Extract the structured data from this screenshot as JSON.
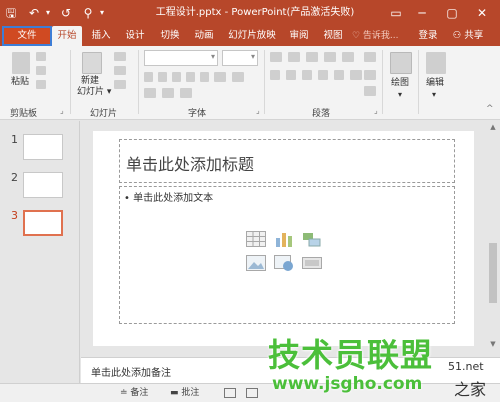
{
  "titlebar": {
    "title": "工程设计.pptx - PowerPoint(产品激活失败)",
    "save_glyph": "🖫",
    "undo_glyph": "↶",
    "redo_glyph": "↺",
    "qa_more_glyph": "⚲",
    "ribbon_display_glyph": "▭",
    "minimize_glyph": "─",
    "restore_glyph": "▢",
    "close_glyph": "✕"
  },
  "tabs": {
    "file": "文件",
    "home": "开始",
    "insert": "插入",
    "design": "设计",
    "transitions": "切换",
    "animations": "动画",
    "slideshow": "幻灯片放映",
    "review": "审阅",
    "view": "视图",
    "tellme": "♡ 告诉我...",
    "login": "登录",
    "share": "⚇ 共享"
  },
  "ribbon": {
    "clipboard_label": "剪贴板",
    "paste_label": "粘贴",
    "slides_label": "幻灯片",
    "new_slide_label_1": "新建",
    "new_slide_label_2": "幻灯片 ▾",
    "font_label": "字体",
    "paragraph_label": "段落",
    "drawing_label": "绘图",
    "editing_label": "编辑",
    "collapse_glyph": "^",
    "launcher_glyph": "⌟"
  },
  "thumbnails": [
    {
      "num": "1"
    },
    {
      "num": "2"
    },
    {
      "num": "3"
    }
  ],
  "slide": {
    "title_placeholder": "单击此处添加标题",
    "body_placeholder": "• 单击此处添加文本"
  },
  "notes": {
    "placeholder": "单击此处添加备注"
  },
  "status": {
    "notes": "≐ 备注",
    "comments": "▬ 批注"
  },
  "watermark": {
    "main": "技术员联盟",
    "sub": "www.jsgho.com",
    "partial": "51.net",
    "home": "之家"
  },
  "colors": {
    "accent": "#b7472a",
    "file_outline": "#3d7dd6",
    "selected_thumb": "#e0714f",
    "watermark": "#4bbf3a"
  }
}
